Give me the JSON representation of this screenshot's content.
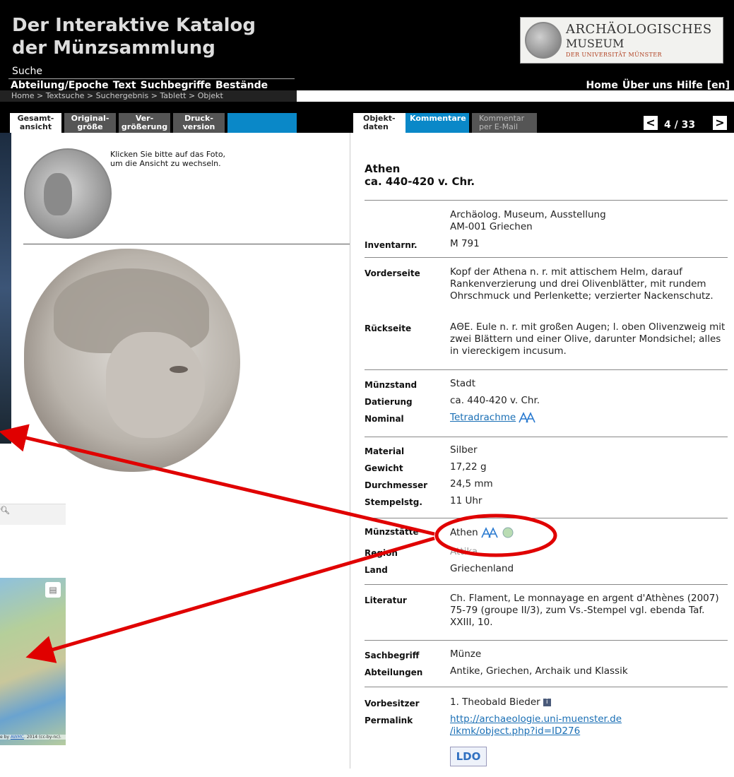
{
  "header": {
    "title_line1": "Der Interaktive Katalog",
    "title_line2": "der Münzsammlung",
    "search_label": "Suche",
    "nav_left": [
      "Abteilung/Epoche",
      "Text",
      "Suchbegriffe",
      "Bestände"
    ],
    "nav_right": [
      "Home",
      "Über uns",
      "Hilfe",
      "[en]"
    ],
    "logo": {
      "line1": "ARCHÄOLOGISCHES",
      "line2": "MUSEUM",
      "line3": "DER UNIVERSITÄT MÜNSTER"
    }
  },
  "breadcrumb": "Home > Textsuche > Suchergebnis > Tablett > Objekt",
  "tabs": {
    "gesamt": [
      "Gesamt-",
      "ansicht"
    ],
    "original": [
      "Original-",
      "größe"
    ],
    "ver": [
      "Ver-",
      "größerung"
    ],
    "druck": [
      "Druck-",
      "version"
    ],
    "objekt": [
      "Objekt-",
      "daten"
    ],
    "kommentare": "Kommentare",
    "mail": [
      "Kommentar",
      "per E-Mail"
    ]
  },
  "pager": {
    "prev": "<",
    "count": "4 / 33",
    "next": ">"
  },
  "left": {
    "thumb_hint": "Klicken Sie bitte auf das Foto,\num die Ansicht zu wechseln.",
    "search_icon": "magnifier-icon",
    "map_layers_icon": "layers-icon",
    "map_credit_prefix": "e by ",
    "map_credit_link": "AWMC",
    "map_credit_suffix": ". 2014 (cc-by-nc)."
  },
  "object": {
    "title1": "Athen",
    "title2": "ca. 440-420 v. Chr.",
    "location_line1": "Archäolog. Museum, Ausstellung",
    "location_line2": "AM-001 Griechen",
    "inventar_label": "Inventarnr.",
    "inventar": "M 791",
    "vorderseite_label": "Vorderseite",
    "vorderseite": "Kopf der Athena n. r. mit attischem Helm, darauf Rankenverzierung und drei Olivenblätter, mit rundem Ohrschmuck und Perlenkette; verzierter Nackenschutz.",
    "rueckseite_label": "Rückseite",
    "rueckseite": "AΘE. Eule n. r. mit großen Augen; l. oben Olivenzweig mit zwei Blättern und einer Olive, darunter Mondsichel; alles in viereckigem incusum.",
    "muenzstand_label": "Münzstand",
    "muenzstand": "Stadt",
    "datierung_label": "Datierung",
    "datierung": "ca. 440-420 v. Chr.",
    "nominal_label": "Nominal",
    "nominal": "Tetradrachme",
    "material_label": "Material",
    "material": "Silber",
    "gewicht_label": "Gewicht",
    "gewicht": "17,22 g",
    "durchmesser_label": "Durchmesser",
    "durchmesser": "24,5 mm",
    "stempel_label": "Stempelstg.",
    "stempel": "11 Uhr",
    "muenzstaette_label": "Münzstätte",
    "muenzstaette": "Athen",
    "region_label": "Region",
    "region": "Attika",
    "land_label": "Land",
    "land": "Griechenland",
    "literatur_label": "Literatur",
    "literatur": "Ch. Flament, Le monnayage en argent d'Athènes (2007) 75-79 (groupe II/3), zum Vs.-Stempel vgl. ebenda Taf. XXIII, 10.",
    "sachbegriff_label": "Sachbegriff",
    "sachbegriff": "Münze",
    "abteilungen_label": "Abteilungen",
    "abteilungen": "Antike, Griechen, Archaik und Klassik",
    "vorbesitzer_label": "Vorbesitzer",
    "vorbesitzer": "1. Theobald Bieder",
    "permalink_label": "Permalink",
    "permalink_line1": "http://archaeologie.uni-muenster.de",
    "permalink_line2": "/ikmk/object.php?id=ID276",
    "ldo_badge": "LDO"
  },
  "colors": {
    "tab_blue": "#0a88c8",
    "annotation_red": "#e00000",
    "link_blue": "#1a6fb5"
  }
}
